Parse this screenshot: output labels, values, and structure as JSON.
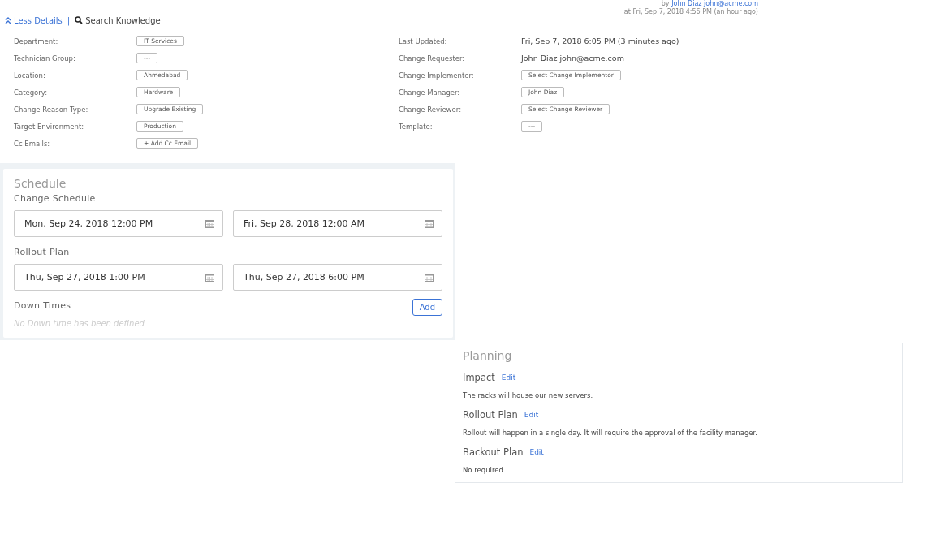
{
  "header": {
    "separator": "|",
    "links": [
      {
        "kind": "toggle",
        "label": "Less Details"
      },
      {
        "kind": "search",
        "label": "Search Knowledge"
      }
    ],
    "created_by": {
      "prefix": "by",
      "name": "John Diaz",
      "email": "john@acme.com"
    },
    "created_at": "at Fri, Sep 7, 2018 4:56 PM (an hour ago)"
  },
  "details_left": [
    {
      "label": "Department:",
      "value": "IT Services",
      "kind": "chip"
    },
    {
      "label": "Technician Group:",
      "value": "---",
      "kind": "chip"
    },
    {
      "label": "Location:",
      "value": "Ahmedabad",
      "kind": "chip"
    },
    {
      "label": "Category:",
      "value": "Hardware",
      "kind": "chip"
    },
    {
      "label": "Change Reason Type:",
      "value": "Upgrade Existing",
      "kind": "chip"
    },
    {
      "label": "Target Environment:",
      "value": "Production",
      "kind": "chip"
    },
    {
      "label": "Cc Emails:",
      "value": "+ Add Cc Email",
      "kind": "chip"
    }
  ],
  "details_right": [
    {
      "label": "Last Updated:",
      "value": "Fri, Sep 7, 2018 6:05 PM (3 minutes ago)",
      "kind": "text"
    },
    {
      "label": "Change Requester:",
      "value": "John Diaz john@acme.com",
      "kind": "text"
    },
    {
      "label": "Change Implementer:",
      "value": "Select Change Implementor",
      "kind": "chip"
    },
    {
      "label": "Change Manager:",
      "value": "John Diaz",
      "kind": "chip"
    },
    {
      "label": "Change Reviewer:",
      "value": "Select Change Reviewer",
      "kind": "chip"
    },
    {
      "label": "Template:",
      "value": "---",
      "kind": "chip"
    }
  ],
  "schedule": {
    "title": "Schedule",
    "groups": [
      {
        "label": "Change Schedule",
        "start": "Mon, Sep 24, 2018 12:00 PM",
        "end": "Fri, Sep 28, 2018 12:00 AM"
      },
      {
        "label": "Rollout Plan",
        "start": "Thu, Sep 27, 2018 1:00 PM",
        "end": "Thu, Sep 27, 2018 6:00 PM"
      }
    ],
    "down_times": {
      "label": "Down Times",
      "button": "Add",
      "empty": "No Down time has been defined"
    }
  },
  "planning": {
    "title": "Planning",
    "sections": [
      {
        "heading": "Impact",
        "action": "Edit",
        "text": "The racks will house our new servers."
      },
      {
        "heading": "Rollout Plan",
        "action": "Edit",
        "text": "Rollout will happen in a single day. It will require the approval of the facility manager."
      },
      {
        "heading": "Backout Plan",
        "action": "Edit",
        "text": "No required."
      }
    ]
  }
}
